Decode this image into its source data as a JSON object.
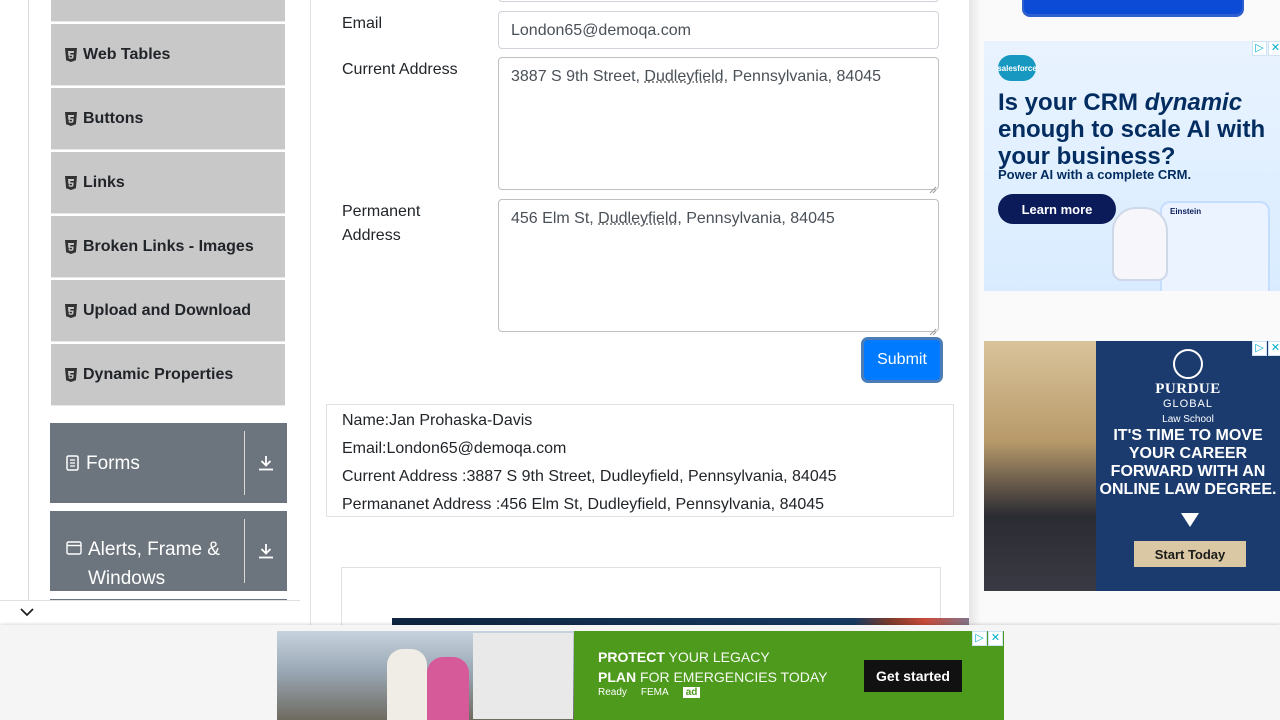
{
  "sidebar": {
    "items": [
      {
        "label": "Web Tables"
      },
      {
        "label": "Buttons"
      },
      {
        "label": "Links"
      },
      {
        "label": "Broken Links - Images"
      },
      {
        "label": "Upload and Download"
      },
      {
        "label": "Dynamic Properties"
      }
    ],
    "groups": [
      {
        "label": "Forms"
      },
      {
        "label": "Alerts, Frame & Windows"
      }
    ]
  },
  "form": {
    "email_label": "Email",
    "email_value": "London65@demoqa.com",
    "current_label": "Current Address",
    "current_value": {
      "a": "3887 S 9th Street, ",
      "b": "Dudleyfield",
      "c": ", Pennsylvania, 84045"
    },
    "permanent_label": "Permanent Address",
    "permanent_value": {
      "a": "456 Elm St, ",
      "b": "Dudleyfield",
      "c": ", Pennsylvania, 84045"
    },
    "submit_label": "Submit"
  },
  "output": {
    "name": "Name:Jan Prohaska-Davis",
    "email": "Email:London65@demoqa.com",
    "current": "Current Address :3887 S 9th Street, Dudleyfield, Pennsylvania, 84045",
    "permanent": "Permananet Address :456 Elm St, Dudleyfield, Pennsylvania, 84045"
  },
  "ads": {
    "salesforce": {
      "logo": "salesforce",
      "headline_pre": "Is your CRM ",
      "headline_em": "dynamic",
      "headline_post": " enough to scale AI with your business?",
      "sub": "Power AI with a complete CRM.",
      "cta": "Learn more",
      "chat_name": "Einstein"
    },
    "purdue": {
      "brand1": "PURDUE",
      "brand2": "GLOBAL",
      "brand3": "Law School",
      "pitch": "IT'S TIME TO MOVE YOUR CAREER FORWARD WITH AN ONLINE LAW DEGREE.",
      "cta": "Start Today"
    },
    "bottom": {
      "line1_bold": "PROTECT",
      "line1_rest": " YOUR LEGACY",
      "line2_bold": "PLAN",
      "line2_rest": " FOR EMERGENCIES TODAY",
      "logo1": "Ready",
      "logo2": "FEMA",
      "logo3": "ad",
      "cta": "Get started"
    }
  },
  "colors": {
    "primary": "#007bff",
    "menu_bg": "#c8c8c8",
    "group_bg": "#6c757d",
    "ad_green": "#4e9a1c"
  }
}
